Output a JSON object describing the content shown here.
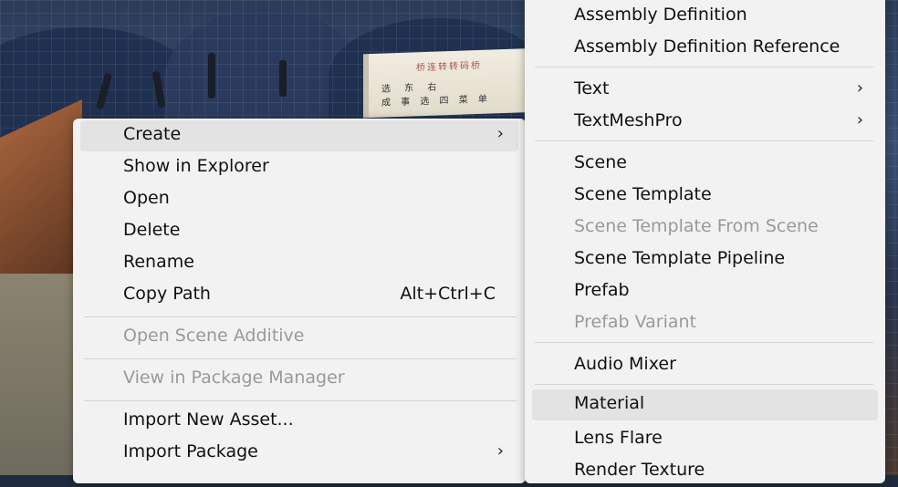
{
  "scene": {
    "banner_line1": "桥连转转码桥",
    "banner_line2": "选 东 右",
    "banner_line3": "成 事 选 四 菜 单"
  },
  "context_menu": {
    "items": [
      {
        "label": "Create",
        "arrow": "›"
      },
      {
        "label": "Show in Explorer"
      },
      {
        "label": "Open"
      },
      {
        "label": "Delete"
      },
      {
        "label": "Rename"
      },
      {
        "label": "Copy Path",
        "shortcut": "Alt+Ctrl+C"
      },
      {
        "label": "Open Scene Additive"
      },
      {
        "label": "View in Package Manager"
      },
      {
        "label": "Import New Asset..."
      },
      {
        "label": "Import Package",
        "arrow": "›"
      }
    ]
  },
  "create_submenu": {
    "items": [
      {
        "label": "Assembly Definition"
      },
      {
        "label": "Assembly Definition Reference"
      },
      {
        "label": "Text",
        "arrow": "›"
      },
      {
        "label": "TextMeshPro",
        "arrow": "›"
      },
      {
        "label": "Scene"
      },
      {
        "label": "Scene Template"
      },
      {
        "label": "Scene Template From Scene"
      },
      {
        "label": "Scene Template Pipeline"
      },
      {
        "label": "Prefab"
      },
      {
        "label": "Prefab Variant"
      },
      {
        "label": "Audio Mixer"
      },
      {
        "label": "Material"
      },
      {
        "label": "Lens Flare"
      },
      {
        "label": "Render Texture"
      }
    ]
  }
}
